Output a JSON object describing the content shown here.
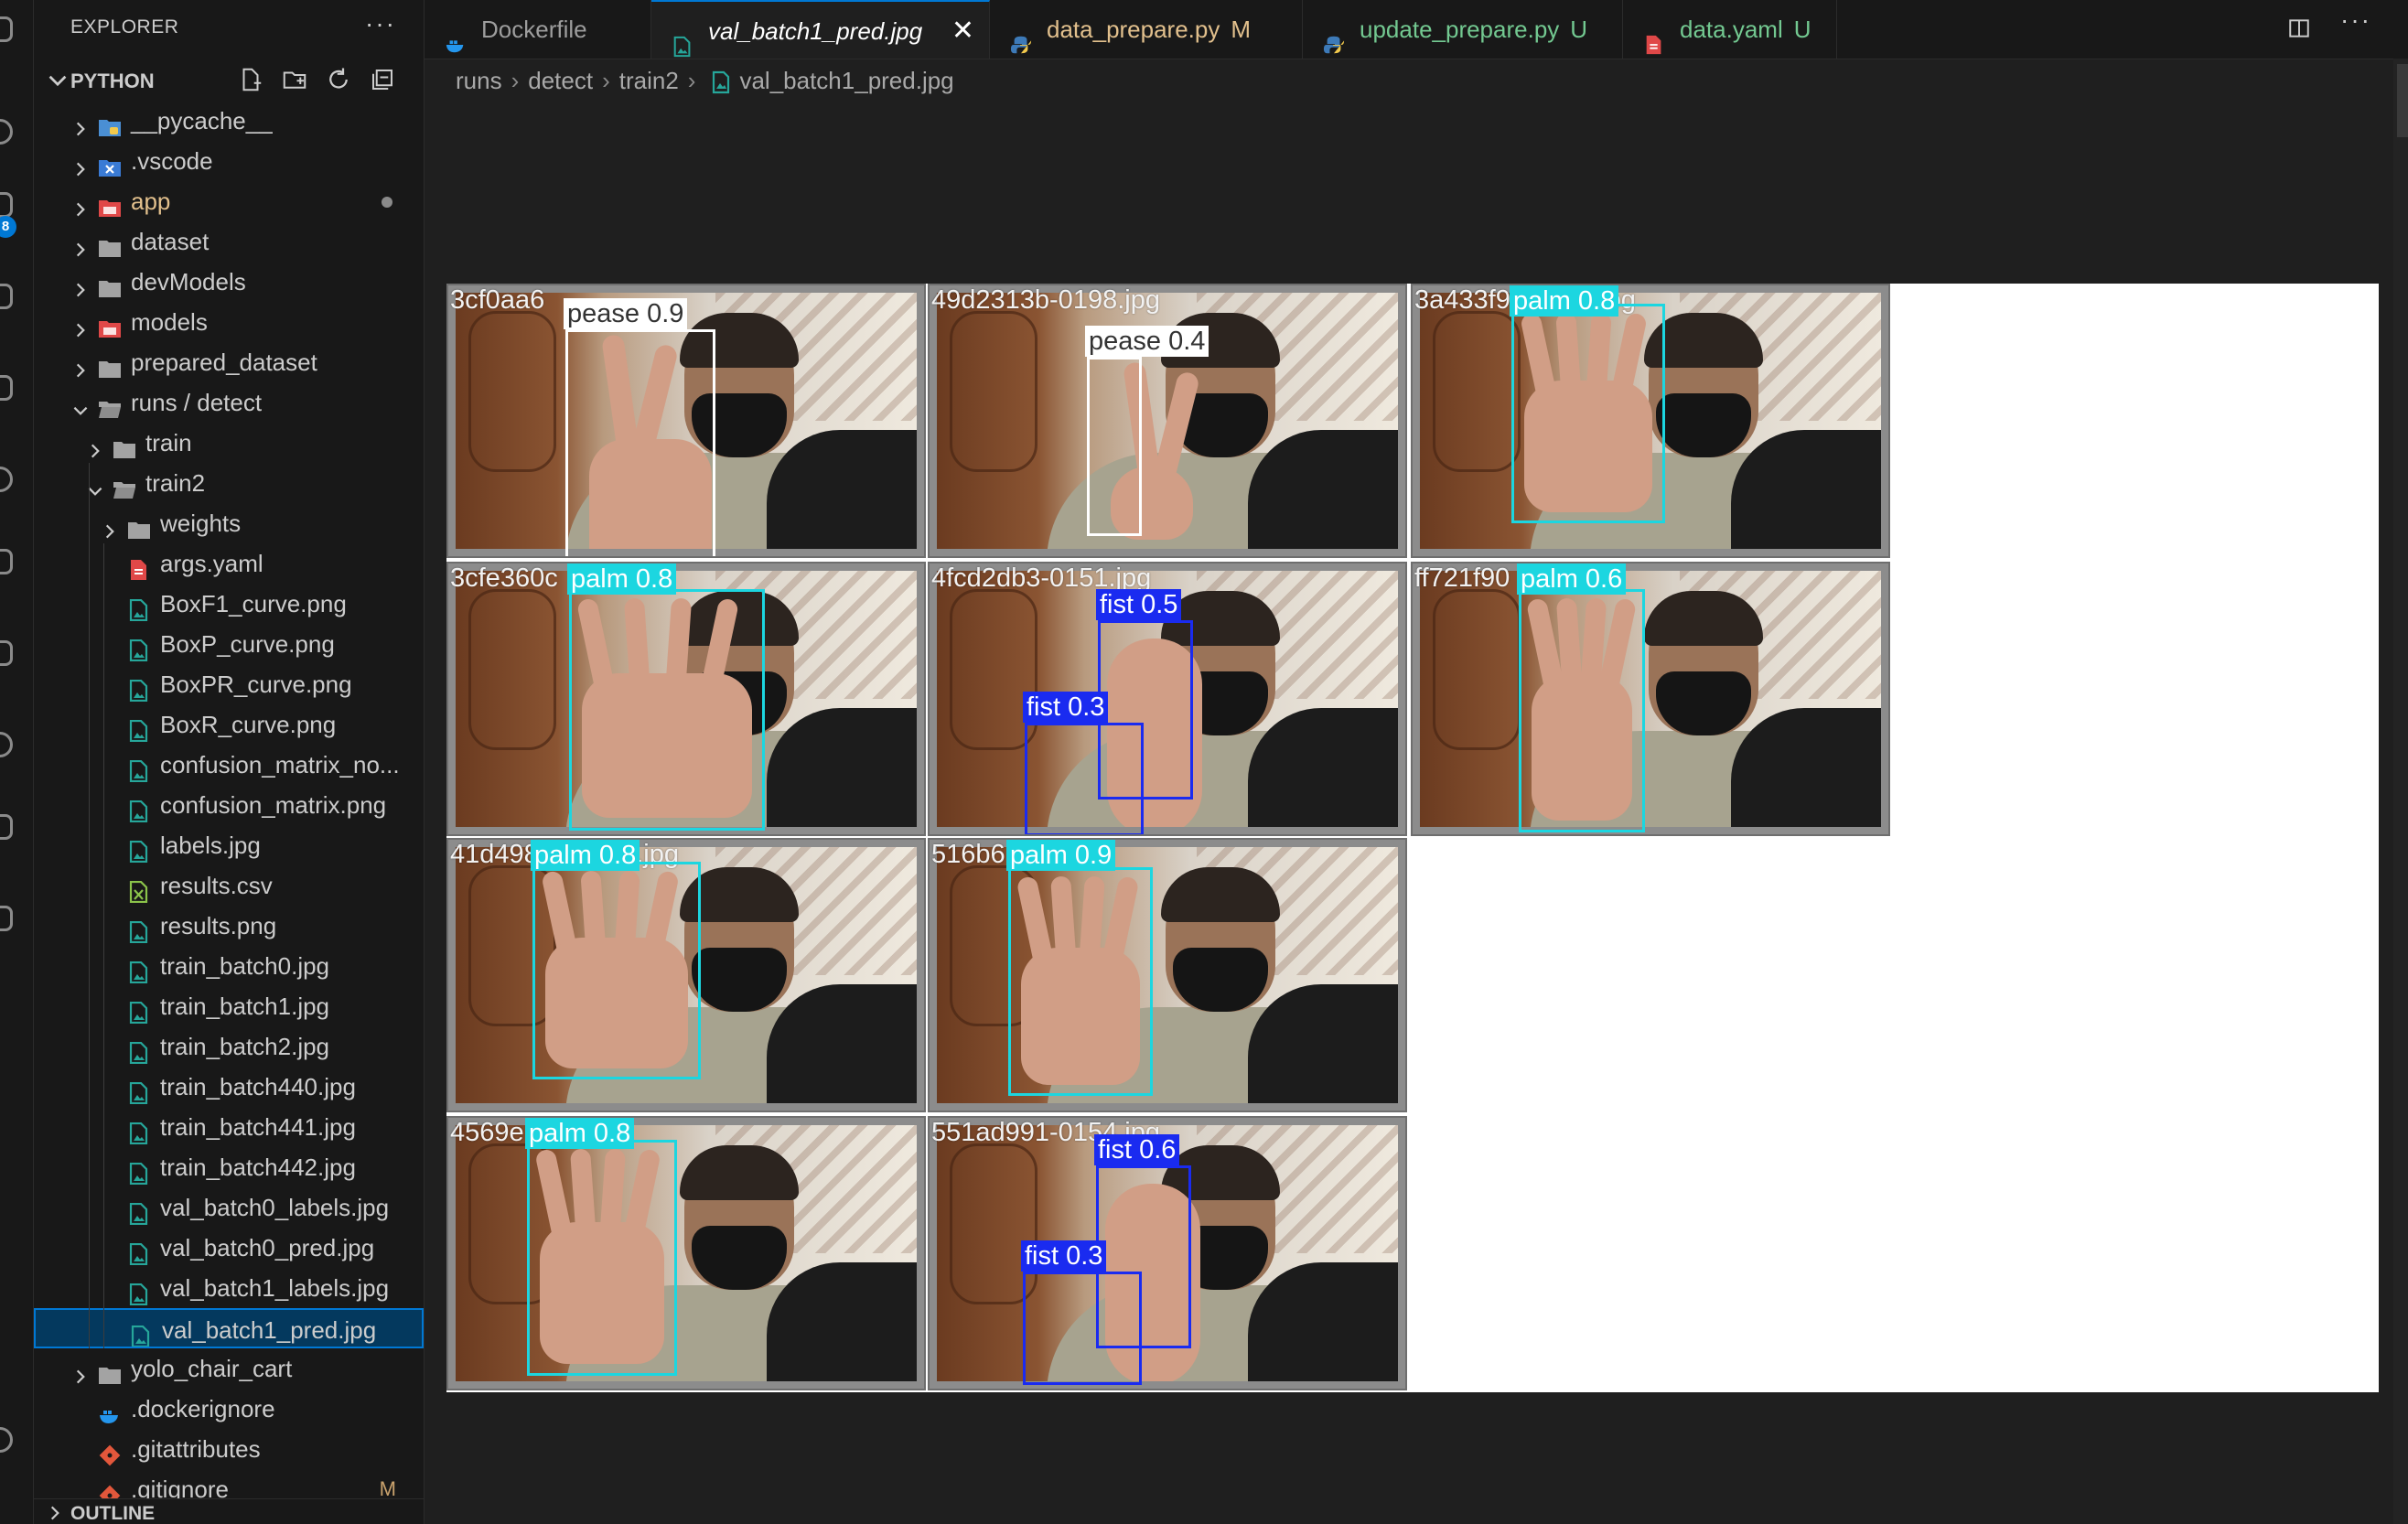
{
  "sidebar": {
    "title": "EXPLORER",
    "more": "···",
    "section": "PYTHON",
    "outline": "OUTLINE",
    "items": [
      {
        "label": "__pycache__",
        "kind": "folder-py",
        "depth": 0,
        "chev": "right"
      },
      {
        "label": ".vscode",
        "kind": "folder-vscode",
        "depth": 0,
        "chev": "right"
      },
      {
        "label": "app",
        "kind": "folder-red",
        "depth": 0,
        "chev": "right",
        "color": "#e2c08d",
        "dot": true
      },
      {
        "label": "dataset",
        "kind": "folder",
        "depth": 0,
        "chev": "right"
      },
      {
        "label": "devModels",
        "kind": "folder",
        "depth": 0,
        "chev": "right"
      },
      {
        "label": "models",
        "kind": "folder-red",
        "depth": 0,
        "chev": "right"
      },
      {
        "label": "prepared_dataset",
        "kind": "folder",
        "depth": 0,
        "chev": "right"
      },
      {
        "label": "runs / detect",
        "kind": "folder-open",
        "depth": 0,
        "chev": "down"
      },
      {
        "label": "train",
        "kind": "folder",
        "depth": 1,
        "chev": "right"
      },
      {
        "label": "train2",
        "kind": "folder-open",
        "depth": 1,
        "chev": "down"
      },
      {
        "label": "weights",
        "kind": "folder",
        "depth": 2,
        "chev": "right"
      },
      {
        "label": "args.yaml",
        "kind": "yaml",
        "depth": 2
      },
      {
        "label": "BoxF1_curve.png",
        "kind": "image",
        "depth": 2
      },
      {
        "label": "BoxP_curve.png",
        "kind": "image",
        "depth": 2
      },
      {
        "label": "BoxPR_curve.png",
        "kind": "image",
        "depth": 2
      },
      {
        "label": "BoxR_curve.png",
        "kind": "image",
        "depth": 2
      },
      {
        "label": "confusion_matrix_no...",
        "kind": "image",
        "depth": 2
      },
      {
        "label": "confusion_matrix.png",
        "kind": "image",
        "depth": 2
      },
      {
        "label": "labels.jpg",
        "kind": "image",
        "depth": 2
      },
      {
        "label": "results.csv",
        "kind": "csv",
        "depth": 2
      },
      {
        "label": "results.png",
        "kind": "image",
        "depth": 2
      },
      {
        "label": "train_batch0.jpg",
        "kind": "image",
        "depth": 2
      },
      {
        "label": "train_batch1.jpg",
        "kind": "image",
        "depth": 2
      },
      {
        "label": "train_batch2.jpg",
        "kind": "image",
        "depth": 2
      },
      {
        "label": "train_batch440.jpg",
        "kind": "image",
        "depth": 2
      },
      {
        "label": "train_batch441.jpg",
        "kind": "image",
        "depth": 2
      },
      {
        "label": "train_batch442.jpg",
        "kind": "image",
        "depth": 2
      },
      {
        "label": "val_batch0_labels.jpg",
        "kind": "image",
        "depth": 2
      },
      {
        "label": "val_batch0_pred.jpg",
        "kind": "image",
        "depth": 2
      },
      {
        "label": "val_batch1_labels.jpg",
        "kind": "image",
        "depth": 2
      },
      {
        "label": "val_batch1_pred.jpg",
        "kind": "image",
        "depth": 2,
        "selected": true
      },
      {
        "label": "yolo_chair_cart",
        "kind": "folder",
        "depth": 0,
        "chev": "right"
      },
      {
        "label": ".dockerignore",
        "kind": "docker",
        "depth": 0
      },
      {
        "label": ".gitattributes",
        "kind": "git",
        "depth": 0
      },
      {
        "label": ".gitignore",
        "kind": "git",
        "depth": 0,
        "badge": "M"
      }
    ]
  },
  "tabs": [
    {
      "label": "Dockerfile",
      "icon": "docker",
      "status": "",
      "active": false,
      "color": "#9d9d9d"
    },
    {
      "label": "val_batch1_pred.jpg",
      "icon": "image",
      "status": "",
      "active": true,
      "close": "✕",
      "color": "#ffffff"
    },
    {
      "label": "data_prepare.py",
      "icon": "python",
      "status": "M",
      "active": false,
      "color": "#e2c08d"
    },
    {
      "label": "update_prepare.py",
      "icon": "python",
      "status": "U",
      "active": false,
      "color": "#73c991"
    },
    {
      "label": "data.yaml",
      "icon": "yaml",
      "status": "U",
      "active": false,
      "color": "#73c991"
    }
  ],
  "editor_more": "···",
  "breadcrumb": [
    "runs",
    "detect",
    "train2",
    "val_batch1_pred.jpg"
  ],
  "activity_badge": "8",
  "colors": {
    "pease": "#ffffff",
    "palm": "#1cd6e0",
    "fist": "#1a2bf0",
    "accent": "#0078d4"
  },
  "tiles": [
    {
      "filename": "3cf0aa6",
      "gesture": "pease",
      "detections": [
        {
          "label": "pease 0.9",
          "cls": "pease"
        }
      ]
    },
    {
      "filename": "49d2313b-0198.jpg",
      "gesture": "pease",
      "detections": [
        {
          "label": "pease 0.4",
          "cls": "pease"
        }
      ]
    },
    {
      "filename": "3a433f94-0158.jpg",
      "gesture": "palm",
      "detections": [
        {
          "label": "palm 0.8",
          "cls": "palm"
        }
      ]
    },
    {
      "filename": "3cfe360c",
      "gesture": "palm",
      "detections": [
        {
          "label": "palm 0.8",
          "cls": "palm"
        }
      ]
    },
    {
      "filename": "4fcd2db3-0151.jpg",
      "gesture": "fist",
      "detections": [
        {
          "label": "fist 0.5",
          "cls": "fist"
        },
        {
          "label": "fist 0.3",
          "cls": "fist"
        }
      ]
    },
    {
      "filename": "ff721f90",
      "gesture": "palm",
      "detections": [
        {
          "label": "palm 0.6",
          "cls": "palm"
        }
      ]
    },
    {
      "filename": "41d49838-0160.jpg",
      "gesture": "palm",
      "detections": [
        {
          "label": "palm 0.8",
          "cls": "palm"
        }
      ]
    },
    {
      "filename": "516b6",
      "gesture": "palm",
      "detections": [
        {
          "label": "palm 0.9",
          "cls": "palm"
        }
      ]
    },
    {
      "filename": "4569e",
      "gesture": "palm",
      "detections": [
        {
          "label": "palm 0.8",
          "cls": "palm"
        }
      ]
    },
    {
      "filename": "551ad991-0154.jpg",
      "gesture": "fist",
      "detections": [
        {
          "label": "fist 0.6",
          "cls": "fist"
        },
        {
          "label": "fist 0.3",
          "cls": "fist"
        }
      ]
    }
  ]
}
